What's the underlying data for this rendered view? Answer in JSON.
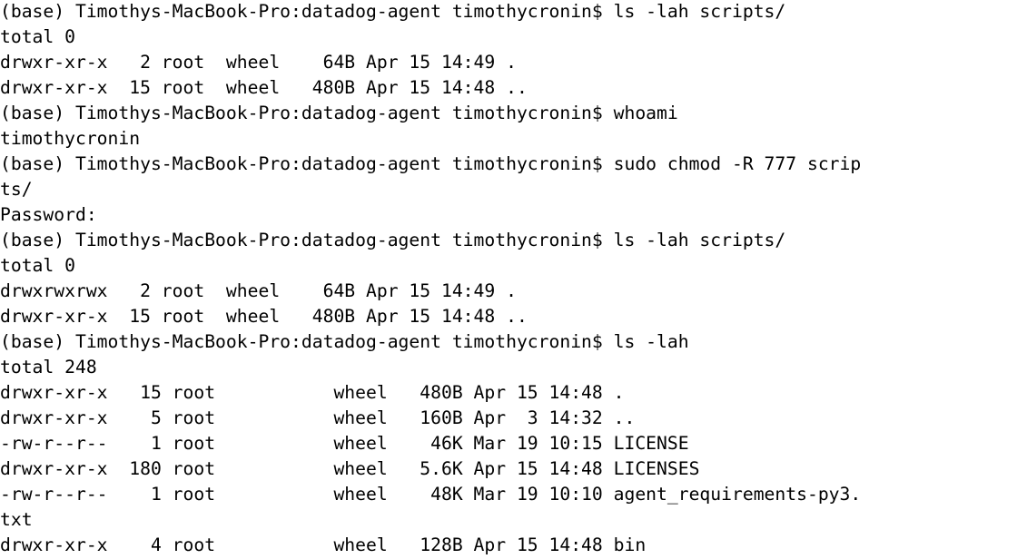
{
  "terminal": {
    "lines": [
      "(base) Timothys-MacBook-Pro:datadog-agent timothycronin$ ls -lah scripts/",
      "total 0",
      "drwxr-xr-x   2 root  wheel    64B Apr 15 14:49 .",
      "drwxr-xr-x  15 root  wheel   480B Apr 15 14:48 ..",
      "(base) Timothys-MacBook-Pro:datadog-agent timothycronin$ whoami",
      "timothycronin",
      "(base) Timothys-MacBook-Pro:datadog-agent timothycronin$ sudo chmod -R 777 scrip",
      "ts/",
      "Password:",
      "(base) Timothys-MacBook-Pro:datadog-agent timothycronin$ ls -lah scripts/",
      "total 0",
      "drwxrwxrwx   2 root  wheel    64B Apr 15 14:49 .",
      "drwxr-xr-x  15 root  wheel   480B Apr 15 14:48 ..",
      "(base) Timothys-MacBook-Pro:datadog-agent timothycronin$ ls -lah",
      "total 248",
      "drwxr-xr-x   15 root           wheel   480B Apr 15 14:48 .",
      "drwxr-xr-x    5 root           wheel   160B Apr  3 14:32 ..",
      "-rw-r--r--    1 root           wheel    46K Mar 19 10:15 LICENSE",
      "drwxr-xr-x  180 root           wheel   5.6K Apr 15 14:48 LICENSES",
      "-rw-r--r--    1 root           wheel    48K Mar 19 10:10 agent_requirements-py3.",
      "txt",
      "drwxr-xr-x    4 root           wheel   128B Apr 15 14:48 bin"
    ]
  }
}
